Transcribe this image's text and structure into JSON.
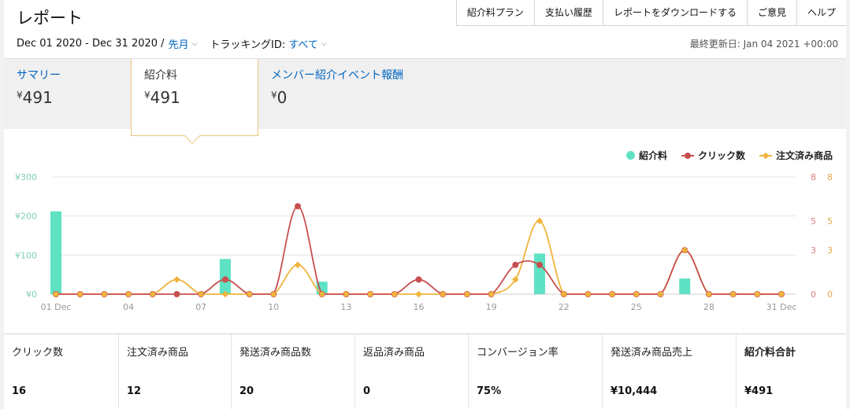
{
  "header": {
    "title": "レポート",
    "nav": [
      "紹介料プラン",
      "支払い履歴",
      "レポートをダウンロードする",
      "ご意見",
      "ヘルプ"
    ]
  },
  "filters": {
    "date_range": "Dec 01 2020 - Dec 31 2020 /",
    "period": "先月",
    "tracking_label": "トラッキングID:",
    "tracking_value": "すべて",
    "last_updated": "最終更新日: Jan 04 2021 +00:00"
  },
  "tabs": [
    {
      "label": "サマリー",
      "value": "491",
      "currency": "¥",
      "active": false
    },
    {
      "label": "紹介料",
      "value": "491",
      "currency": "¥",
      "active": true
    },
    {
      "label": "メンバー紹介イベント報酬",
      "value": "0",
      "currency": "¥",
      "active": false
    }
  ],
  "legend": [
    "紹介料",
    "クリック数",
    "注文済み商品"
  ],
  "colors": {
    "fees": "#5ee2c3",
    "clicks": "#c84f4f",
    "orders": "#f0b43c",
    "link": "#0066c0",
    "tab_border": "#ebc47b"
  },
  "chart_data": {
    "type": "bar+line",
    "x": [
      "01 Dec",
      "02",
      "03",
      "04",
      "05",
      "06",
      "07",
      "08",
      "09",
      "10",
      "11",
      "12",
      "13",
      "14",
      "15",
      "16",
      "17",
      "18",
      "19",
      "20",
      "21",
      "22",
      "23",
      "24",
      "25",
      "26",
      "27",
      "28",
      "29",
      "30",
      "31 Dec"
    ],
    "x_tick_labels": [
      "01 Dec",
      "04",
      "07",
      "10",
      "13",
      "16",
      "19",
      "22",
      "25",
      "28",
      "31 Dec"
    ],
    "y_left": {
      "ticks": [
        "¥0",
        "¥100",
        "¥200",
        "¥300"
      ],
      "ylim": [
        0,
        300
      ]
    },
    "y_right_clicks": {
      "ticks": [
        "0",
        "3",
        "5",
        "8"
      ],
      "ylim": [
        0,
        8
      ]
    },
    "y_right_orders": {
      "ticks": [
        "0",
        "3",
        "5",
        "8"
      ],
      "ylim": [
        0,
        8
      ]
    },
    "series": [
      {
        "name": "紹介料",
        "type": "bar",
        "axis": "left",
        "values": [
          212,
          0,
          0,
          0,
          0,
          0,
          0,
          90,
          0,
          0,
          0,
          32,
          0,
          0,
          0,
          0,
          0,
          0,
          0,
          0,
          104,
          0,
          0,
          0,
          0,
          0,
          40,
          0,
          0,
          0,
          0
        ]
      },
      {
        "name": "クリック数",
        "type": "line",
        "axis": "right",
        "values": [
          0,
          0,
          0,
          0,
          0,
          0,
          0,
          1,
          0,
          0,
          6,
          0,
          0,
          0,
          0,
          1,
          0,
          0,
          0,
          2,
          2,
          0,
          0,
          0,
          0,
          0,
          3,
          0,
          0,
          0,
          0
        ]
      },
      {
        "name": "注文済み商品",
        "type": "line",
        "axis": "right",
        "values": [
          0,
          0,
          0,
          0,
          0,
          1,
          0,
          0,
          0,
          0,
          2,
          0,
          0,
          0,
          0,
          0,
          0,
          0,
          0,
          1,
          5,
          0,
          0,
          0,
          0,
          0,
          3,
          0,
          0,
          0,
          0
        ]
      }
    ],
    "grid": true,
    "legend_position": "top-right"
  },
  "metrics": [
    {
      "label": "クリック数",
      "value": "16"
    },
    {
      "label": "注文済み商品",
      "value": "12"
    },
    {
      "label": "発送済み商品数",
      "value": "20"
    },
    {
      "label": "返品済み商品",
      "value": "0"
    },
    {
      "label": "コンバージョン率",
      "value": "75%"
    },
    {
      "label": "発送済み商品売上",
      "value": "¥10,444"
    },
    {
      "label": "紹介料合計",
      "value": "¥491"
    }
  ]
}
